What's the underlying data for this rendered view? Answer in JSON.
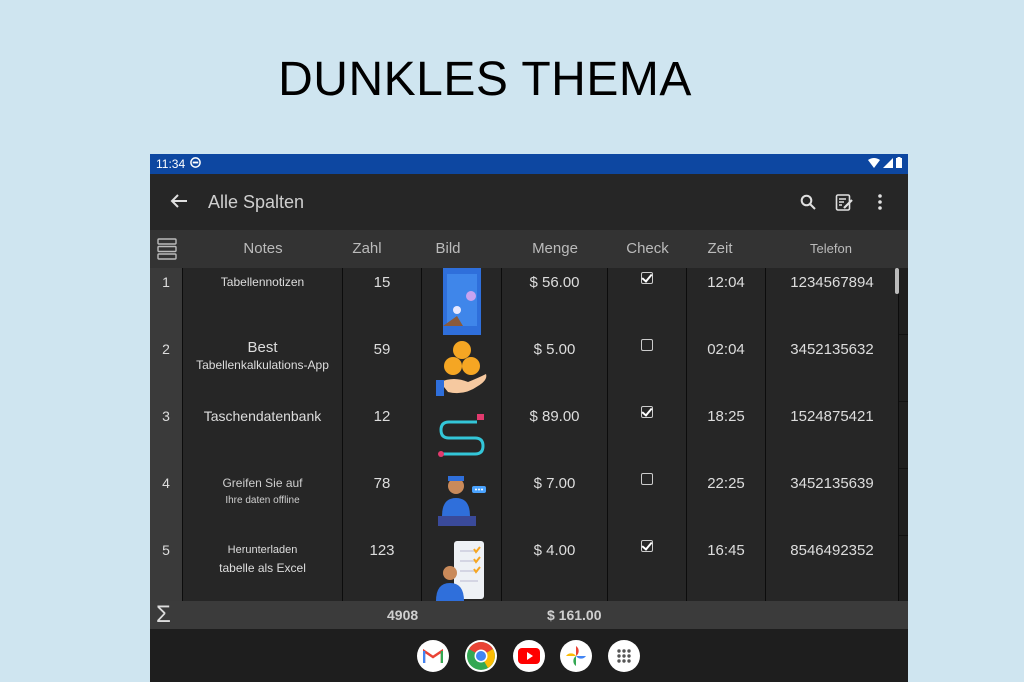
{
  "headline": "DUNKLES THEMA",
  "status": {
    "time": "11:34"
  },
  "appbar": {
    "title": "Alle Spalten"
  },
  "columns": [
    "Notes",
    "Zahl",
    "Bild",
    "Menge",
    "Check",
    "Zeit",
    "Telefon"
  ],
  "rows": [
    {
      "index": "1",
      "notes_line1": "Tabellennotizen",
      "notes_line2": "",
      "zahl": "15",
      "image": "phone-app-illustration",
      "menge": "$ 56.00",
      "checked": true,
      "zeit": "12:04",
      "telefon": "1234567894"
    },
    {
      "index": "2",
      "notes_line1": "Best",
      "notes_line2": "Tabellenkalkulations-App",
      "zahl": "59",
      "image": "hand-coins-illustration",
      "menge": "$ 5.00",
      "checked": false,
      "zeit": "02:04",
      "telefon": "3452135632"
    },
    {
      "index": "3",
      "notes_line1": "Taschendatenbank",
      "notes_line2": "",
      "zahl": "12",
      "image": "route-path-illustration",
      "menge": "$ 89.00",
      "checked": true,
      "zeit": "18:25",
      "telefon": "1524875421"
    },
    {
      "index": "4",
      "notes_line1": "Greifen Sie auf",
      "notes_line2": "Ihre daten offline",
      "zahl": "78",
      "image": "person-laptop-illustration",
      "menge": "$ 7.00",
      "checked": false,
      "zeit": "22:25",
      "telefon": "3452135639"
    },
    {
      "index": "5",
      "notes_line1": "Herunterladen",
      "notes_line2": "tabelle als Excel",
      "zahl": "123",
      "image": "checklist-person-illustration",
      "menge": "$ 4.00",
      "checked": true,
      "zeit": "16:45",
      "telefon": "8546492352"
    }
  ],
  "totals": {
    "zahl": "4908",
    "menge": "$ 161.00"
  },
  "dock": [
    "gmail-icon",
    "chrome-icon",
    "youtube-icon",
    "photos-icon",
    "apps-icon"
  ]
}
